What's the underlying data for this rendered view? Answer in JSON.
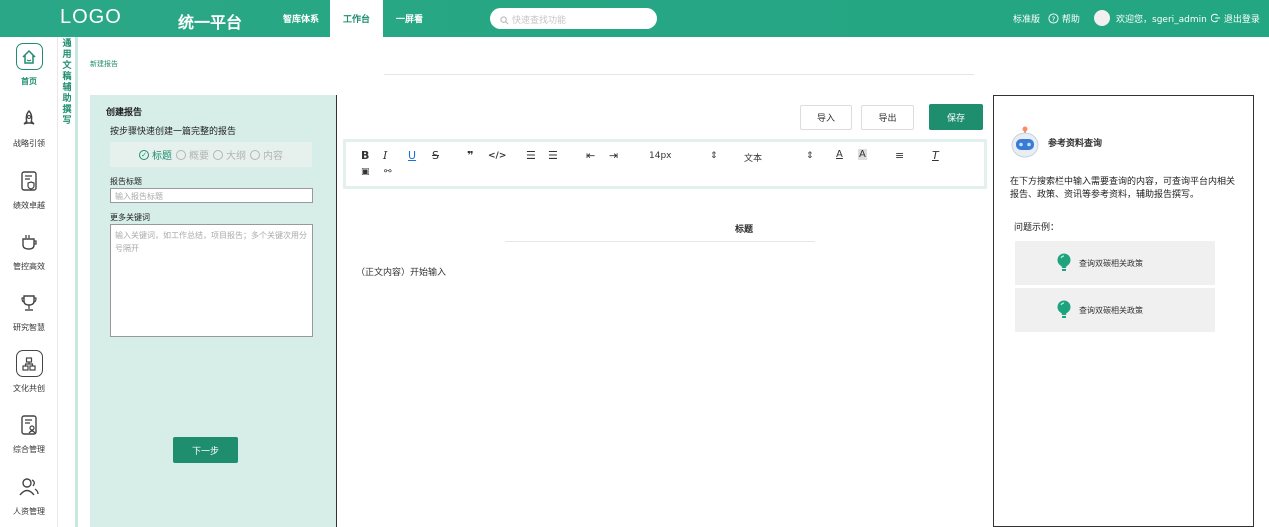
{
  "header": {
    "logo": "LOGO",
    "platform": "统一平台",
    "tabs": [
      "智库体系",
      "工作台",
      "一屏看"
    ],
    "search_placeholder": "快速查找功能",
    "edition": "标准版",
    "help": "帮助",
    "welcome": "欢迎您，sgeri_admin",
    "logout": "退出登录"
  },
  "sidebar": {
    "items": [
      {
        "label": "首页",
        "icon": "home-icon"
      },
      {
        "label": "战略引领",
        "icon": "rocket-icon"
      },
      {
        "label": "绩效卓越",
        "icon": "document-shield-icon"
      },
      {
        "label": "管控高效",
        "icon": "cup-icon"
      },
      {
        "label": "研究智慧",
        "icon": "trophy-icon"
      },
      {
        "label": "文化共创",
        "icon": "org-chart-icon"
      },
      {
        "label": "综合管理",
        "icon": "document-person-icon"
      },
      {
        "label": "人资管理",
        "icon": "people-icon"
      }
    ],
    "vertical_title": "通用文稿辅助撰写"
  },
  "breadcrumb": "新建报告",
  "create": {
    "title": "创建报告",
    "subtitle": "按步骤快速创建一篇完整的报告",
    "steps": [
      "标题",
      "概要",
      "大纲",
      "内容"
    ],
    "title_label": "报告标题",
    "title_placeholder": "输入报告标题",
    "keywords_label": "更多关键词",
    "keywords_placeholder": "输入关键词，如工作总结，项目报告；多个关键次用分号隔开",
    "next": "下一步"
  },
  "editor": {
    "import": "导入",
    "export": "导出",
    "save": "保存",
    "font_size": "14px",
    "block_type": "文本",
    "doc_title": "标题",
    "doc_body": "（正文内容）开始输入"
  },
  "reference": {
    "title": "参考资料查询",
    "description": "在下方搜索栏中输入需要查询的内容，可查询平台内相关报告、政策、资讯等参考资料，辅助报告撰写。",
    "examples_label": "问题示例：",
    "examples": [
      "查询双碳相关政策",
      "查询双碳相关政策"
    ]
  },
  "colors": {
    "brand": "#23a682",
    "accent_dark": "#1f8e6f",
    "panel_bg": "#d7ede8"
  }
}
